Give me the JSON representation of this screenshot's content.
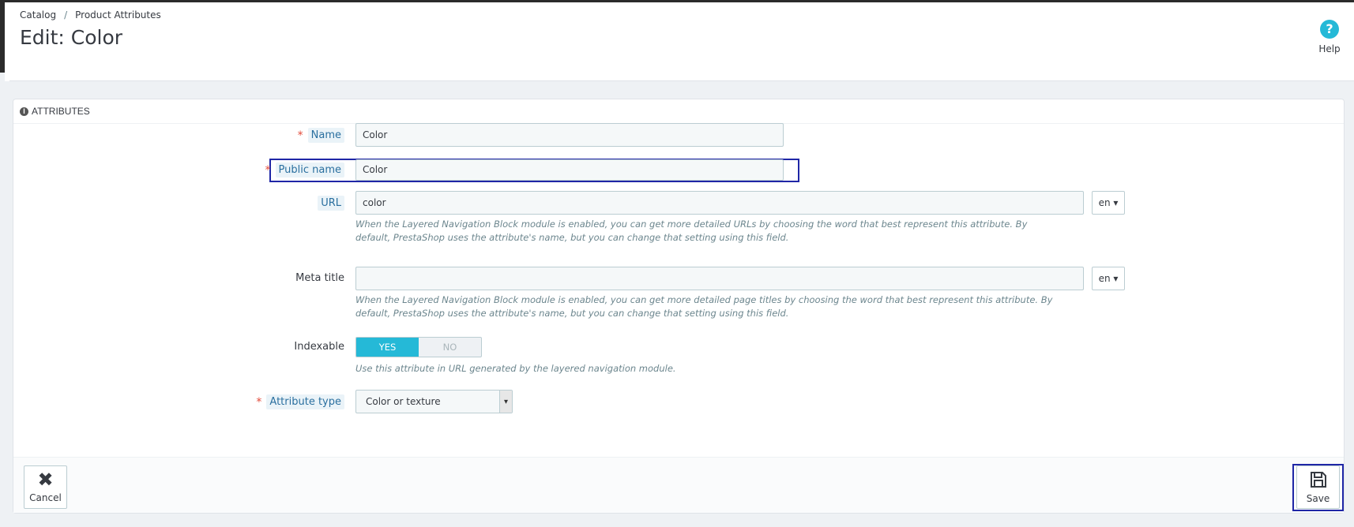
{
  "breadcrumb": {
    "catalog": "Catalog",
    "separator": "/",
    "current": "Product Attributes"
  },
  "page_title": "Edit: Color",
  "help": {
    "icon_glyph": "?",
    "label": "Help"
  },
  "panel": {
    "heading_icon": "i",
    "heading": "Attributes"
  },
  "form": {
    "name": {
      "required": "*",
      "label": "Name",
      "value": "Color"
    },
    "public_name": {
      "required": "*",
      "label": "Public name",
      "value": "Color"
    },
    "url": {
      "label": "URL",
      "value": "color",
      "lang": "en ▾",
      "help": "When the Layered Navigation Block module is enabled, you can get more detailed URLs by choosing the word that best represent this attribute. By default, PrestaShop uses the attribute's name, but you can change that setting using this field."
    },
    "meta_title": {
      "label": "Meta title",
      "value": "",
      "lang": "en ▾",
      "help": "When the Layered Navigation Block module is enabled, you can get more detailed page titles by choosing the word that best represent this attribute. By default, PrestaShop uses the attribute's name, but you can change that setting using this field."
    },
    "indexable": {
      "label": "Indexable",
      "yes": "YES",
      "no": "NO",
      "selected": "YES",
      "help": "Use this attribute in URL generated by the layered navigation module."
    },
    "attribute_type": {
      "required": "*",
      "label": "Attribute type",
      "value": "Color or texture",
      "caret": "▾"
    }
  },
  "footer": {
    "cancel_label": "Cancel",
    "cancel_glyph": "✖",
    "save_label": "Save"
  },
  "colors": {
    "accent": "#25b9d7",
    "required": "#e24b3b",
    "highlight_box": "#1f26a6"
  }
}
